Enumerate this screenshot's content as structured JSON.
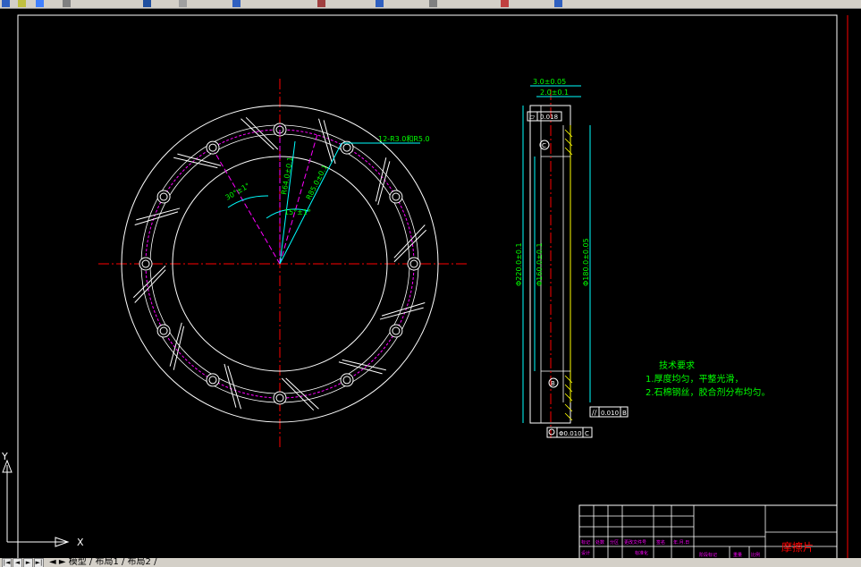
{
  "part": {
    "center_angle_label": "30°±1°",
    "offset_angle_label": "15°±1°",
    "bolt_circle_dim": "R64.0±0.1",
    "outer_dim": "R85.0±0.1",
    "hole_callout": "12-R3.0和R5.0"
  },
  "section": {
    "top_dim_1": "3.0±0.05",
    "top_dim_2": "2.0±0.1",
    "flatness_value": "0.018",
    "dia_outer": "Φ220.0±0.1",
    "dia_mid": "Φ160.0±0.1",
    "dia_inner": "Φ180.0±0.05",
    "datum_c": "C",
    "datum_b": "B",
    "parallel_value": "0.010",
    "parallel_datum": "B",
    "runout_value": "Φ0.010",
    "runout_datum": "C"
  },
  "notes": {
    "heading": "技术要求",
    "line1": "1.厚度均匀，平整光滑，",
    "line2": "2.石棉钢丝，胶合剂分布均匀。"
  },
  "title_block": {
    "part_name": "摩擦片",
    "row1": [
      "标记",
      "处数",
      "分区",
      "更改文件号",
      "签名",
      "年.月.日"
    ],
    "row2": [
      "设计",
      "",
      "",
      "标准化",
      ""
    ],
    "mark_col": [
      "阶段标记",
      "重量",
      "比例"
    ]
  },
  "tabs": "◄ ► 模型 / 布局1 / 布局2 /",
  "ucs": {
    "x": "X",
    "y": "Y"
  },
  "colors": {
    "background": "#000000",
    "line": "#ffffff",
    "center": "#ff0000",
    "dim": "#00ffff",
    "text": "#00ff00",
    "hidden": "#ff00ff"
  }
}
